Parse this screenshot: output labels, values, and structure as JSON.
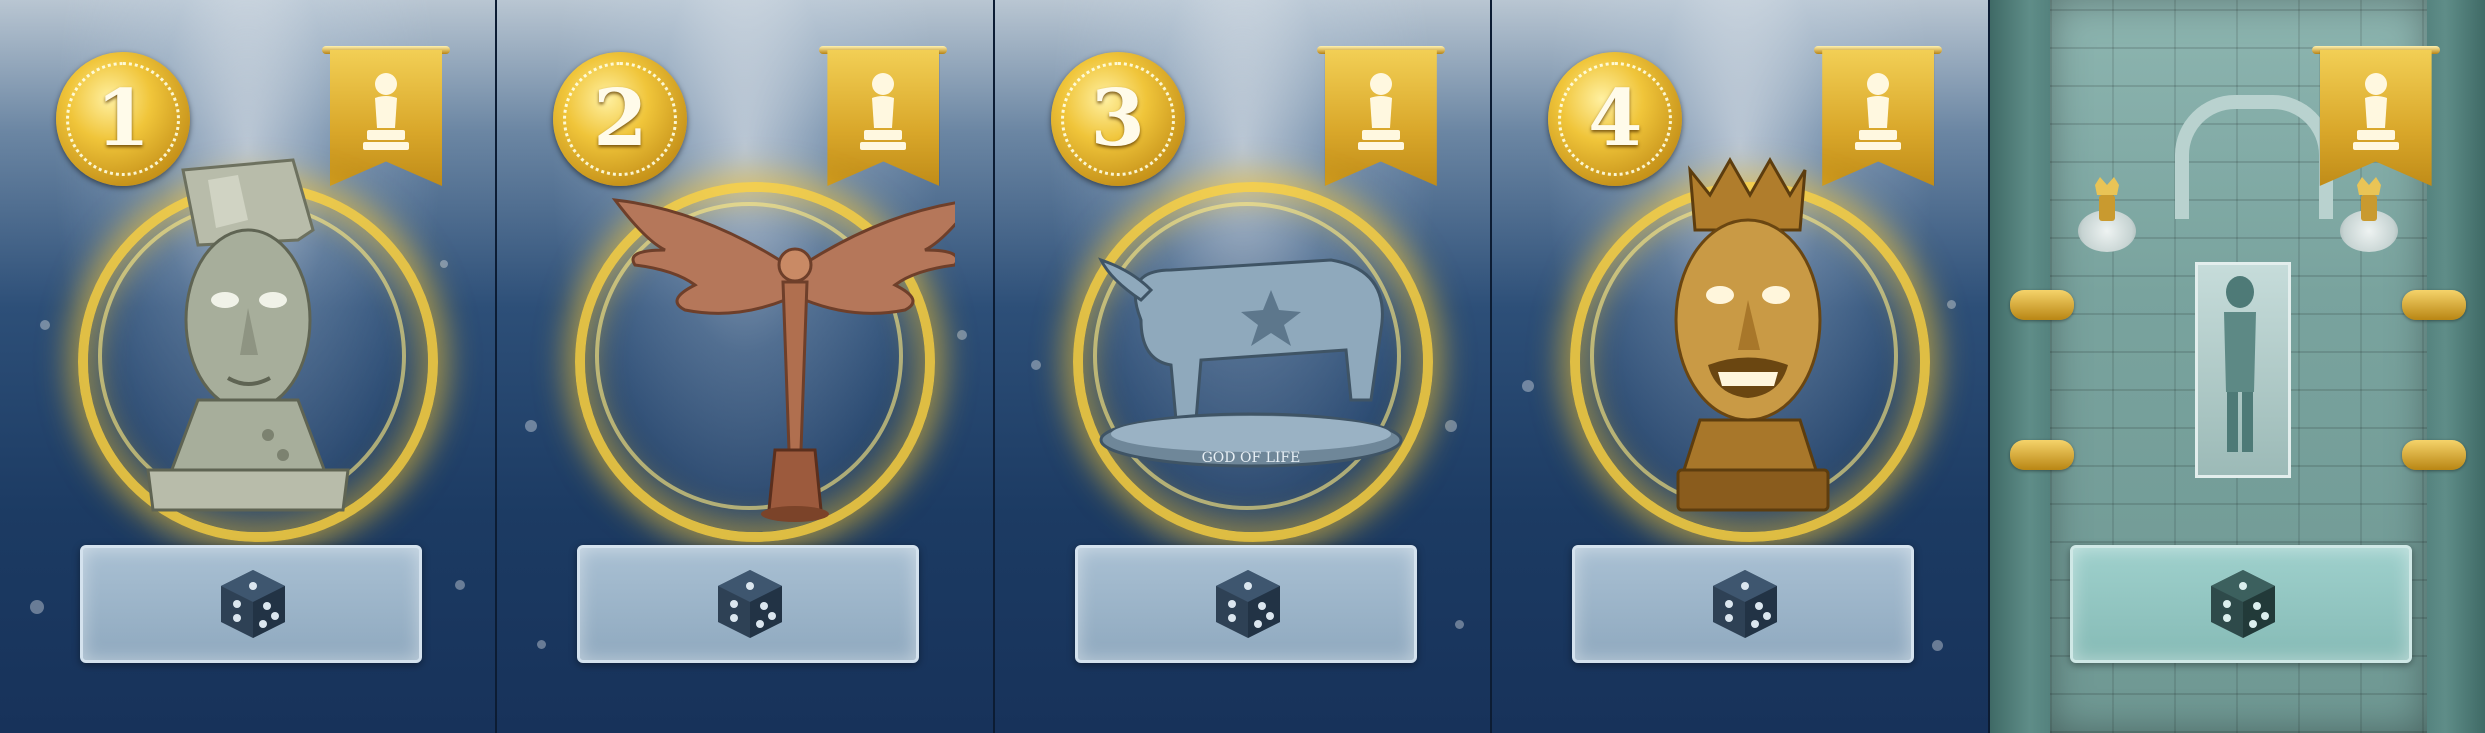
{
  "cards": [
    {
      "id": "card-1",
      "number": "1",
      "statue": "stone-bust-icon",
      "statue_label": ""
    },
    {
      "id": "card-2",
      "number": "2",
      "statue": "winged-figure-icon",
      "statue_label": ""
    },
    {
      "id": "card-3",
      "number": "3",
      "statue": "bull-statue-icon",
      "statue_label": "GOD OF LIFE"
    },
    {
      "id": "card-4",
      "number": "4",
      "statue": "golden-crowned-head-icon",
      "statue_label": ""
    }
  ],
  "tomb_card": {
    "id": "card-5",
    "scene": "tomb-chamber"
  },
  "icons": {
    "banner": "pawn-icon",
    "dice": "die-icon"
  },
  "colors": {
    "gold": "#e1b233",
    "ring_glow": "#ffd23c",
    "card_blue": "#1c3b63",
    "dice_box": "#9ab3c8",
    "tomb_teal": "#6c9a95"
  }
}
